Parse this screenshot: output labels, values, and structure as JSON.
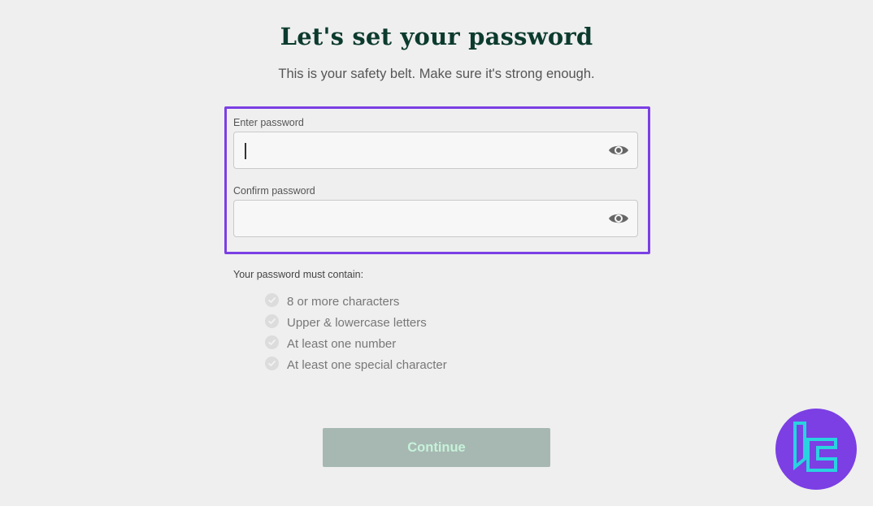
{
  "header": {
    "title": "Let's set your password",
    "subtitle": "This is your safety belt. Make sure it's strong enough."
  },
  "form": {
    "password": {
      "label": "Enter password",
      "value": "",
      "placeholder": "",
      "toggle_icon": "eye-icon"
    },
    "confirm": {
      "label": "Confirm password",
      "value": "",
      "placeholder": "",
      "toggle_icon": "eye-icon"
    }
  },
  "requirements": {
    "heading": "Your password must contain:",
    "items": [
      {
        "label": "8 or more characters",
        "met": false
      },
      {
        "label": "Upper & lowercase letters",
        "met": false
      },
      {
        "label": "At least one number",
        "met": false
      },
      {
        "label": "At least one special character",
        "met": false
      }
    ]
  },
  "actions": {
    "continue_label": "Continue",
    "continue_enabled": false
  },
  "colors": {
    "background": "#efefef",
    "title": "#0c3b2e",
    "highlight": "#7b3fe4",
    "button_disabled_bg": "#a7b8b2",
    "button_disabled_text": "#c6f2da",
    "logo_bg": "#7b3fe4",
    "logo_mark": "#29d3e0"
  },
  "watermark": {
    "icon": "tradingfinder-logo-icon"
  }
}
